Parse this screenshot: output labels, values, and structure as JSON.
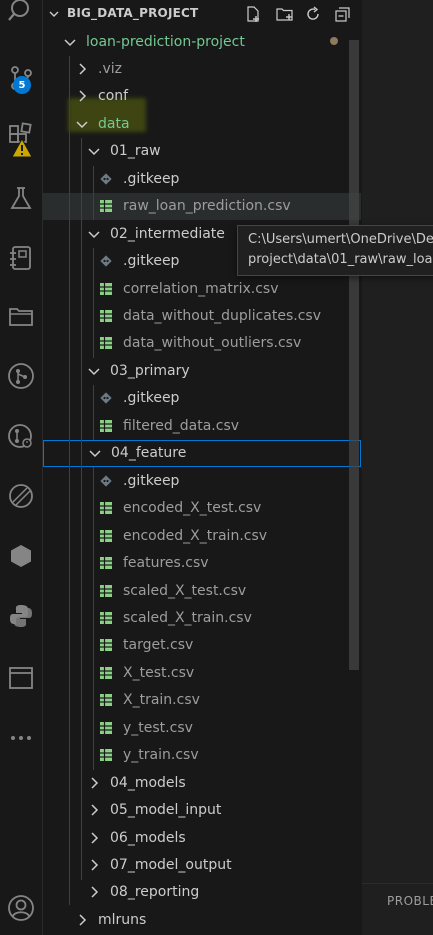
{
  "activity_bar": {
    "source_control_badge": "5"
  },
  "explorer": {
    "root_title": "BIG_DATA_PROJECT",
    "items": [
      {
        "label": "loan-prediction-project",
        "kind": "folder",
        "open": true,
        "color": "green"
      },
      {
        "label": ".viz",
        "kind": "folder",
        "open": false,
        "color": "dim"
      },
      {
        "label": "conf",
        "kind": "folder",
        "open": false,
        "color": "normal"
      },
      {
        "label": "data",
        "kind": "folder",
        "open": true,
        "color": "green"
      },
      {
        "label": "01_raw",
        "kind": "folder",
        "open": true,
        "color": "normal"
      },
      {
        "label": ".gitkeep",
        "kind": "gitkeep",
        "color": "normal"
      },
      {
        "label": "raw_loan_prediction.csv",
        "kind": "csv",
        "color": "dim"
      },
      {
        "label": "02_intermediate",
        "kind": "folder",
        "open": true,
        "color": "normal"
      },
      {
        "label": ".gitkeep",
        "kind": "gitkeep",
        "color": "normal"
      },
      {
        "label": "correlation_matrix.csv",
        "kind": "csv",
        "color": "dim"
      },
      {
        "label": "data_without_duplicates.csv",
        "kind": "csv",
        "color": "dim"
      },
      {
        "label": "data_without_outliers.csv",
        "kind": "csv",
        "color": "dim"
      },
      {
        "label": "03_primary",
        "kind": "folder",
        "open": true,
        "color": "normal"
      },
      {
        "label": ".gitkeep",
        "kind": "gitkeep",
        "color": "normal"
      },
      {
        "label": "filtered_data.csv",
        "kind": "csv",
        "color": "dim"
      },
      {
        "label": "04_feature",
        "kind": "folder",
        "open": true,
        "color": "normal"
      },
      {
        "label": ".gitkeep",
        "kind": "gitkeep",
        "color": "normal"
      },
      {
        "label": "encoded_X_test.csv",
        "kind": "csv",
        "color": "dim"
      },
      {
        "label": "encoded_X_train.csv",
        "kind": "csv",
        "color": "dim"
      },
      {
        "label": "features.csv",
        "kind": "csv",
        "color": "dim"
      },
      {
        "label": "scaled_X_test.csv",
        "kind": "csv",
        "color": "dim"
      },
      {
        "label": "scaled_X_train.csv",
        "kind": "csv",
        "color": "dim"
      },
      {
        "label": "target.csv",
        "kind": "csv",
        "color": "dim"
      },
      {
        "label": "X_test.csv",
        "kind": "csv",
        "color": "dim"
      },
      {
        "label": "X_train.csv",
        "kind": "csv",
        "color": "dim"
      },
      {
        "label": "y_test.csv",
        "kind": "csv",
        "color": "dim"
      },
      {
        "label": "y_train.csv",
        "kind": "csv",
        "color": "dim"
      },
      {
        "label": "04_models",
        "kind": "folder",
        "open": false,
        "color": "normal"
      },
      {
        "label": "05_model_input",
        "kind": "folder",
        "open": false,
        "color": "normal"
      },
      {
        "label": "06_models",
        "kind": "folder",
        "open": false,
        "color": "normal"
      },
      {
        "label": "07_model_output",
        "kind": "folder",
        "open": false,
        "color": "normal"
      },
      {
        "label": "08_reporting",
        "kind": "folder",
        "open": false,
        "color": "normal"
      },
      {
        "label": "mlruns",
        "kind": "folder",
        "open": false,
        "color": "normal"
      }
    ]
  },
  "tooltip": {
    "line1": "C:\\Users\\umert\\OneDrive\\De",
    "line2": "project\\data\\01_raw\\raw_loa"
  },
  "panel": {
    "problems_label": "PROBLE"
  },
  "colors": {
    "accent": "#0078d4",
    "green_text": "#73c991",
    "csv_icon": "#89d185",
    "warning": "#cca700"
  }
}
